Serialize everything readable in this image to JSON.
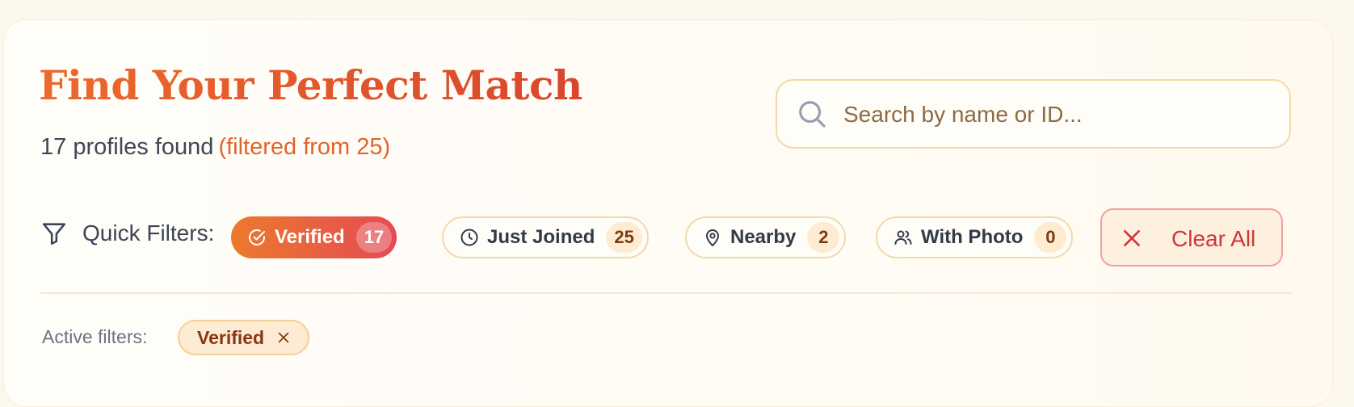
{
  "header": {
    "title": "Find Your Perfect Match",
    "count_text": "17 profiles found",
    "filtered_text": "(filtered from 25)"
  },
  "search": {
    "placeholder": "Search by name or ID...",
    "value": ""
  },
  "quick_filters": {
    "label": "Quick Filters:",
    "chips": [
      {
        "label": "Verified",
        "count": "17",
        "active": true,
        "icon": "check-circle-icon"
      },
      {
        "label": "Just Joined",
        "count": "25",
        "active": false,
        "icon": "clock-icon"
      },
      {
        "label": "Nearby",
        "count": "2",
        "active": false,
        "icon": "map-pin-icon"
      },
      {
        "label": "With Photo",
        "count": "0",
        "active": false,
        "icon": "users-icon"
      }
    ],
    "clear_label": "Clear All"
  },
  "active_filters": {
    "label": "Active filters:",
    "tags": [
      {
        "label": "Verified"
      }
    ]
  },
  "colors": {
    "accent": "#e0652b",
    "danger": "#d2353b",
    "chip_border": "#f3d9a9"
  }
}
